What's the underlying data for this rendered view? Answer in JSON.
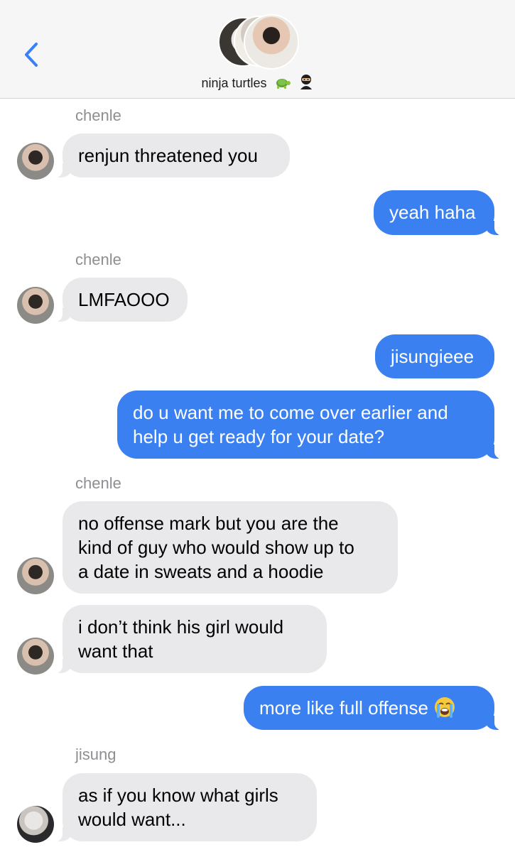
{
  "header": {
    "back_icon": "chevron-left-icon",
    "group_name": "ninja turtles",
    "group_emojis": [
      "turtle-emoji",
      "ninja-emoji"
    ]
  },
  "messages": [
    {
      "sender": "chenle",
      "text": "renjun threatened you"
    },
    {
      "text": "yeah haha"
    },
    {
      "sender": "chenle",
      "text": "LMFAOOO"
    },
    {
      "text": "jisungieee"
    },
    {
      "lines": [
        "do u want me to come over earlier and",
        "help u get ready for your date?"
      ]
    },
    {
      "sender": "chenle",
      "lines": [
        "no offense mark but you are the",
        "kind of guy who would show up to",
        "a date in sweats and a hoodie"
      ]
    },
    {
      "lines": [
        "i don’t think his girl would",
        "want that"
      ]
    },
    {
      "text": "more like full offense",
      "emoji": "loudly-crying-face-emoji"
    },
    {
      "sender": "jisung",
      "lines": [
        "as if you know what girls",
        "would want..."
      ]
    }
  ],
  "colors": {
    "incoming_bubble": "#e9e9eb",
    "outgoing_bubble": "#3b80f1",
    "accent": "#3a80f5"
  }
}
